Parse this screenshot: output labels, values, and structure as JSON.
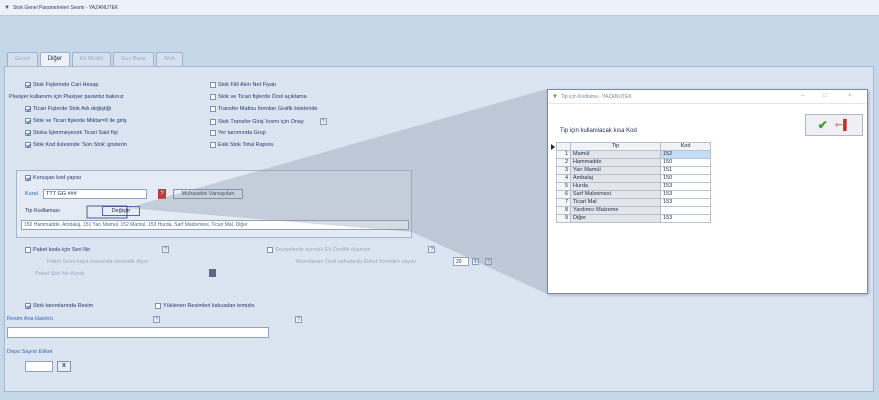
{
  "window": {
    "title": "Stok Genel Parametreleri Sesmi - YAZANUTEK"
  },
  "tabs": [
    {
      "label": "Genel"
    },
    {
      "label": "Diğer"
    },
    {
      "label": "Ek Modül"
    },
    {
      "label": "Gıcr Baha"
    },
    {
      "label": "Web"
    }
  ],
  "left_checks": [
    {
      "label": "Stok Fişlerinde Cari Hesap",
      "checked": true
    },
    {
      "label": "Ticari Fişlerde Stok Adı değiştiği",
      "checked": true
    },
    {
      "label": "Stok ve Ticari fişlerde Miktar=0 ile giriş",
      "checked": true
    },
    {
      "label": "Stoka İşlenmeyecek Ticari Satıl fişi",
      "checked": true
    },
    {
      "label": "Stok Kod listesinde 'Son Stok' gösterin",
      "checked": true
    }
  ],
  "plasiyer_label": "Plasiyer kullanımı için Plasiyer parantız bakınız",
  "right_checks": [
    {
      "label": "Stok Fiili Alım Net Fiyatı"
    },
    {
      "label": "Stok ve Ticari fişlerde Özel açıklama"
    },
    {
      "label": "Transfer Mattsu formları Grafik listeleride"
    },
    {
      "label": "Stok Transfer Giriş' kısmı için Onay"
    },
    {
      "label": "Yer tanımında Grup"
    },
    {
      "label": "Eski Stok Total Raporu"
    }
  ],
  "kod_group": {
    "check_label": "Konuşan kod yapısı",
    "kural_label": "Kural",
    "kural_value": "TTT GG ###",
    "muhasebe_button": "Muhasebe Varsayılan",
    "tip_label": "Tip Kodlaması",
    "degistir_button": "Değiştir",
    "tip_summary": "150 Hammadde, Ambalaj, 151 Yarı Mamul, 152 Mamul, 153 Hurda, Sarf Malzemesi, Ticari Mal, Diğer"
  },
  "paket": {
    "check_label": "Paket kodu için Seri No",
    "sub_label": "Paket Seno kayıt esasında otomatik ölçer",
    "seri_label": "Paket Seri No Kuralı"
  },
  "seviye": {
    "check_label": "Seviyelerde ayrıntılı Ek Özellik düşman",
    "ozel_label": "Tanımlanan Özel sahalarda Etiket Yerinden sayısı",
    "ozel_value": "20"
  },
  "resim": {
    "check_label": "Stok tanımlarında Resim",
    "yuklenen_label": "Yüklenen Resimleri kalıcadan temizle",
    "resim_label": "Resim Ana klasörü",
    "depo_label": "Depo Sayım Etiket",
    "x_button": "X"
  },
  "popup": {
    "title": "Tip için Kodlama - YAZANUTEK",
    "caption": "Tip için kullanılacak kısa Kod",
    "col_tip": "Tip",
    "col_kod": "Kod",
    "rows": [
      {
        "no": "1",
        "tip": "Mamül",
        "kod": "152"
      },
      {
        "no": "2",
        "tip": "Hammadde",
        "kod": "150"
      },
      {
        "no": "3",
        "tip": "Yarı Mamül",
        "kod": "151"
      },
      {
        "no": "4",
        "tip": "Ambalaj",
        "kod": "150"
      },
      {
        "no": "5",
        "tip": "Hurda",
        "kod": "153"
      },
      {
        "no": "6",
        "tip": "Sarf Malzemesi",
        "kod": "153"
      },
      {
        "no": "7",
        "tip": "Ticari Mal",
        "kod": "153"
      },
      {
        "no": "8",
        "tip": "Yardımcı Malzeme",
        "kod": ""
      },
      {
        "no": "9",
        "tip": "Diğer",
        "kod": "153"
      }
    ]
  }
}
